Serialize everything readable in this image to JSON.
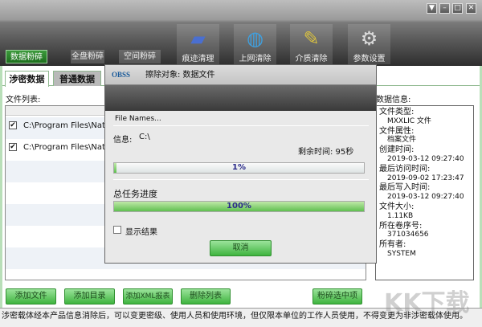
{
  "window_controls": [
    "▼",
    "–",
    "□",
    "✕"
  ],
  "top_tabs": [
    "数据粉碎",
    "全盘粉碎",
    "空间粉碎"
  ],
  "tools": [
    {
      "label": "痕迹清理",
      "icon": "eraser-icon"
    },
    {
      "label": "上网清除",
      "icon": "globe-icon"
    },
    {
      "label": "介质清除",
      "icon": "brush-icon"
    },
    {
      "label": "参数设置",
      "icon": "gear-icon"
    }
  ],
  "sub_tabs": [
    "涉密数据",
    "普通数据"
  ],
  "file_list": {
    "label": "文件列表:",
    "rows": [
      {
        "checked": true,
        "path": "C:\\Program Files\\National"
      },
      {
        "checked": true,
        "path": "C:\\Program Files\\National"
      }
    ]
  },
  "data_info": {
    "label": "数据信息:",
    "fields": [
      {
        "k": "文件类型:",
        "v": "MXXLIC 文件"
      },
      {
        "k": "文件属性:",
        "v": "档案文件"
      },
      {
        "k": "创建时间:",
        "v": "2019-03-12 09:27:40"
      },
      {
        "k": "最后访问时间:",
        "v": "2019-09-02 17:23:47"
      },
      {
        "k": "最后写入时间:",
        "v": "2019-03-12 09:27:40"
      },
      {
        "k": "文件大小:",
        "v": "1.11KB"
      },
      {
        "k": "所在卷序号:",
        "v": "371034656"
      },
      {
        "k": "所有者:",
        "v": "SYSTEM"
      }
    ]
  },
  "buttons": {
    "add_file": "添加文件",
    "add_dir": "添加目录",
    "add_xml": "添加XML报表",
    "delete_list": "删除列表",
    "shred_selected": "粉碎选中项"
  },
  "status": "涉密载体经本产品信息消除后，可以变更密级、使用人员和使用环境，但仅限本单位的工作人员使用，不得变更为非涉密载体使用。",
  "dialog": {
    "logo": "OBSS",
    "title": "擦除对象: 数据文件",
    "file_names": "File Names...",
    "info_label": "信息:",
    "info_value": "C:\\",
    "remaining": "剩余时间: 95秒",
    "progress1": "1%",
    "progress1_value": 1,
    "total_label": "总任务进度",
    "progress2": "100%",
    "progress2_value": 100,
    "show_result": "显示结果",
    "cancel": "取消"
  },
  "watermark": "KK下载"
}
